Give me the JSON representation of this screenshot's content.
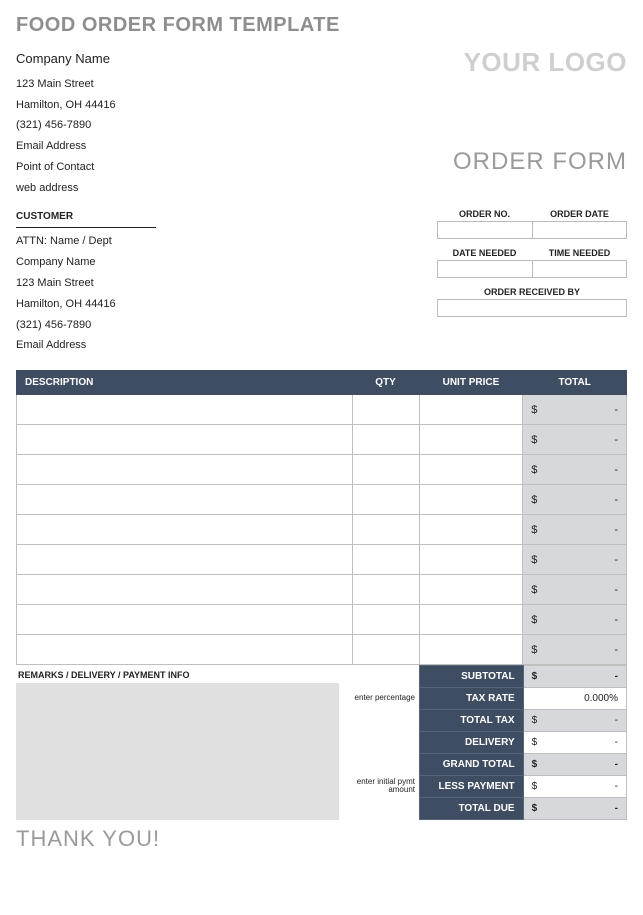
{
  "title": "FOOD ORDER FORM TEMPLATE",
  "logo_text": "YOUR LOGO",
  "order_form_label": "ORDER FORM",
  "thank_you": "THANK YOU!",
  "company": {
    "name": "Company Name",
    "street": "123 Main Street",
    "city": "Hamilton, OH 44416",
    "phone": "(321) 456-7890",
    "email": "Email Address",
    "contact": "Point of Contact",
    "web": "web address"
  },
  "customer": {
    "header": "CUSTOMER",
    "attn": "ATTN: Name / Dept",
    "company": "Company Name",
    "street": "123 Main Street",
    "city": "Hamilton, OH 44416",
    "phone": "(321) 456-7890",
    "email": "Email Address"
  },
  "meta": {
    "order_no_label": "ORDER NO.",
    "order_date_label": "ORDER DATE",
    "date_needed_label": "DATE NEEDED",
    "time_needed_label": "TIME NEEDED",
    "received_by_label": "ORDER RECEIVED BY",
    "order_no": "",
    "order_date": "",
    "date_needed": "",
    "time_needed": "",
    "received_by": ""
  },
  "columns": {
    "description": "DESCRIPTION",
    "qty": "QTY",
    "unit_price": "UNIT PRICE",
    "total": "TOTAL"
  },
  "currency": "$",
  "dash": "-",
  "item_rows": 9,
  "remarks_label": "REMARKS / DELIVERY / PAYMENT INFO",
  "hints": {
    "tax": "enter percentage",
    "less_payment": "enter initial pymt amount"
  },
  "totals": {
    "subtotal_label": "SUBTOTAL",
    "tax_rate_label": "TAX RATE",
    "total_tax_label": "TOTAL TAX",
    "delivery_label": "DELIVERY",
    "grand_total_label": "GRAND TOTAL",
    "less_payment_label": "LESS PAYMENT",
    "total_due_label": "TOTAL DUE",
    "subtotal": "-",
    "tax_rate": "0.000%",
    "total_tax": "-",
    "delivery": "-",
    "grand_total": "-",
    "less_payment": "-",
    "total_due": "-"
  }
}
